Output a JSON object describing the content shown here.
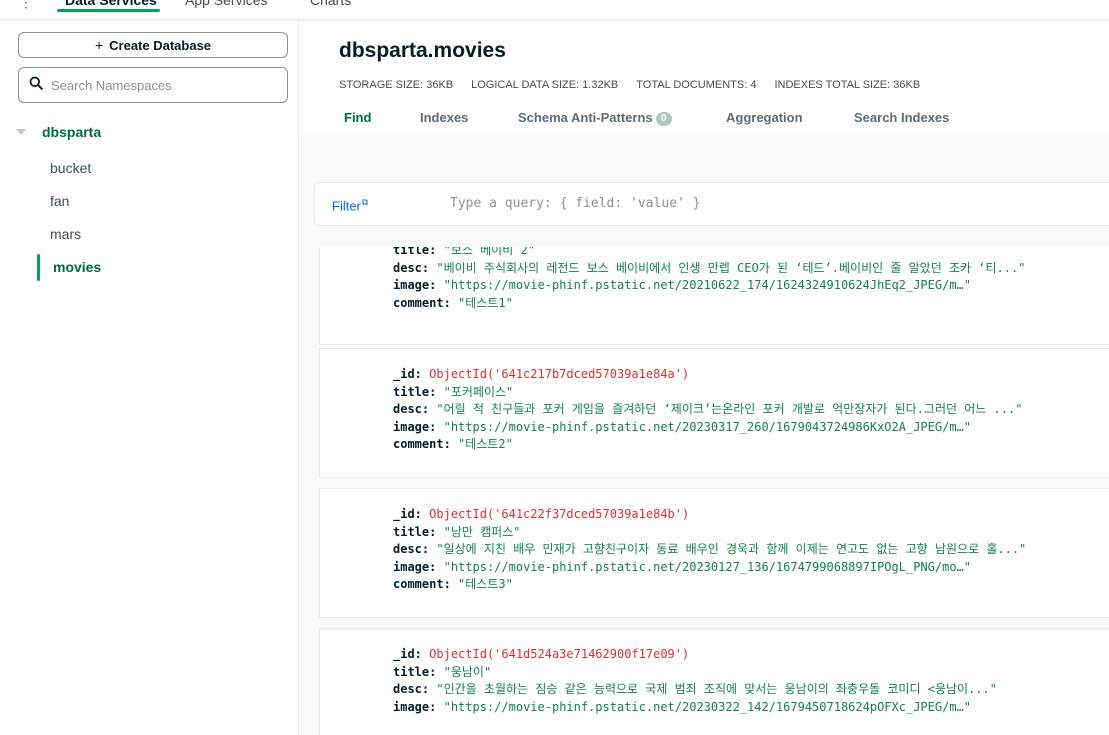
{
  "topnav": {
    "tabs": [
      "Data Services",
      "App Services",
      "Charts"
    ],
    "active_tab": "Data Services"
  },
  "sidebar": {
    "create_button": "Create Database",
    "search_placeholder": "Search Namespaces",
    "database": "dbsparta",
    "collections": [
      "bucket",
      "fan",
      "mars",
      "movies"
    ],
    "active_collection": "movies"
  },
  "main": {
    "namespace": "dbsparta.movies",
    "stats": {
      "storage": "STORAGE SIZE: 36KB",
      "logical": "LOGICAL DATA SIZE: 1.32KB",
      "documents": "TOTAL DOCUMENTS: 4",
      "indexes": "INDEXES TOTAL SIZE: 36KB"
    },
    "tabs": {
      "find": "Find",
      "indexes": "Indexes",
      "schema": "Schema Anti-Patterns",
      "schema_count": "0",
      "aggregation": "Aggregation",
      "search_indexes": "Search Indexes"
    },
    "filter": {
      "label": "Filter",
      "placeholder": "Type a query: { field: 'value' }"
    }
  },
  "documents": [
    {
      "id": "",
      "title": "\"보스 베이비 2\"",
      "desc": "\"베이비 주식회사의 레전드 보스 베이비에서 인생 만렙 CEO가 된 ‘테드’.베이비인 줄 알았던 조카 ‘티...\"",
      "image": "\"https://movie-phinf.pstatic.net/20210622_174/1624324910624JhEq2_JPEG/m…\"",
      "comment": "\"테스트1\""
    },
    {
      "id": "ObjectId('641c217b7dced57039a1e84a')",
      "title": "\"포커페이스\"",
      "desc": "\"어릴 적 친구들과 포커 게임을 즐겨하던 ‘제이크’는온라인 포커 개발로 억만장자가 된다.그러던 어느 ...\"",
      "image": "\"https://movie-phinf.pstatic.net/20230317_260/1679043724986KxO2A_JPEG/m…\"",
      "comment": "\"테스트2\""
    },
    {
      "id": "ObjectId('641c22f37dced57039a1e84b')",
      "title": "\"낭만 캠퍼스\"",
      "desc": "\"일상에 지친 배우 민재가 고향친구이자 동료 배우인 경욱과 함께 이제는 연고도 없는 고향 남원으로 홀...\"",
      "image": "\"https://movie-phinf.pstatic.net/20230127_136/1674799068897IPOgL_PNG/mo…\"",
      "comment": "\"테스트3\""
    },
    {
      "id": "ObjectId('641d524a3e71462900f17e09')",
      "title": "\"웅남이\"",
      "desc": "\"인간을 초월하는 짐승 같은 능력으로 국제 범죄 조직에 맞서는 웅남이의 좌충우돌 코미디 <웅남이...\"",
      "image": "\"https://movie-phinf.pstatic.net/20230322_142/1679450718624pOFXc_JPEG/m…\"",
      "comment": ""
    }
  ],
  "field_keys": {
    "id": "_id:",
    "title": "title:",
    "desc": "desc:",
    "image": "image:",
    "comment": "comment:"
  }
}
